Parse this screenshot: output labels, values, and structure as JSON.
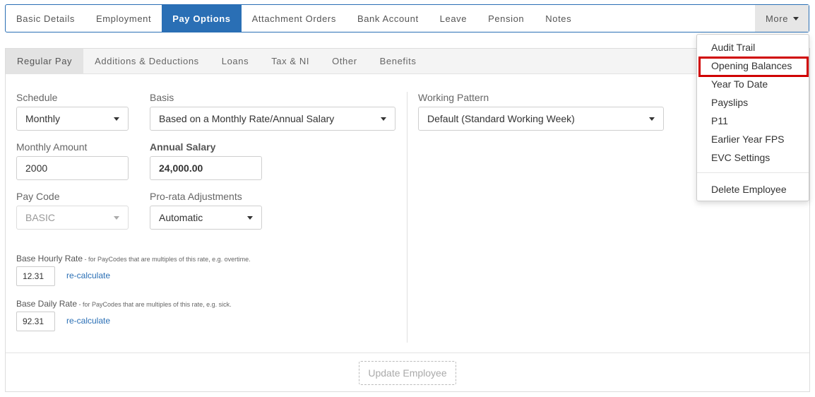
{
  "topnav": {
    "tabs": [
      "Basic Details",
      "Employment",
      "Pay Options",
      "Attachment Orders",
      "Bank Account",
      "Leave",
      "Pension",
      "Notes"
    ],
    "more_label": "More"
  },
  "subnav": {
    "tabs": [
      "Regular Pay",
      "Additions & Deductions",
      "Loans",
      "Tax & NI",
      "Other",
      "Benefits"
    ]
  },
  "form": {
    "schedule": {
      "label": "Schedule",
      "value": "Monthly"
    },
    "basis": {
      "label": "Basis",
      "value": "Based on a Monthly Rate/Annual Salary"
    },
    "working_pattern": {
      "label": "Working Pattern",
      "value": "Default (Standard Working Week)"
    },
    "monthly_amount": {
      "label": "Monthly Amount",
      "value": "2000"
    },
    "annual_salary": {
      "label": "Annual Salary",
      "value": "24,000.00"
    },
    "pay_code": {
      "label": "Pay Code",
      "value": "BASIC"
    },
    "prorata": {
      "label": "Pro-rata Adjustments",
      "value": "Automatic"
    },
    "base_hourly": {
      "label": "Base Hourly Rate",
      "hint": " - for PayCodes that are multiples of this rate, e.g. overtime.",
      "value": "12.31",
      "link": "re-calculate"
    },
    "base_daily": {
      "label": "Base Daily Rate",
      "hint": " - for PayCodes that are multiples of this rate, e.g. sick.",
      "value": "92.31",
      "link": "re-calculate"
    }
  },
  "footer": {
    "update_label": "Update Employee"
  },
  "more_menu": {
    "items": [
      "Audit Trail",
      "Opening Balances",
      "Year To Date",
      "Payslips",
      "P11",
      "Earlier Year FPS",
      "EVC Settings"
    ],
    "delete_label": "Delete Employee"
  },
  "colors": {
    "accent": "#2a6fb5",
    "highlight": "#d00000"
  }
}
